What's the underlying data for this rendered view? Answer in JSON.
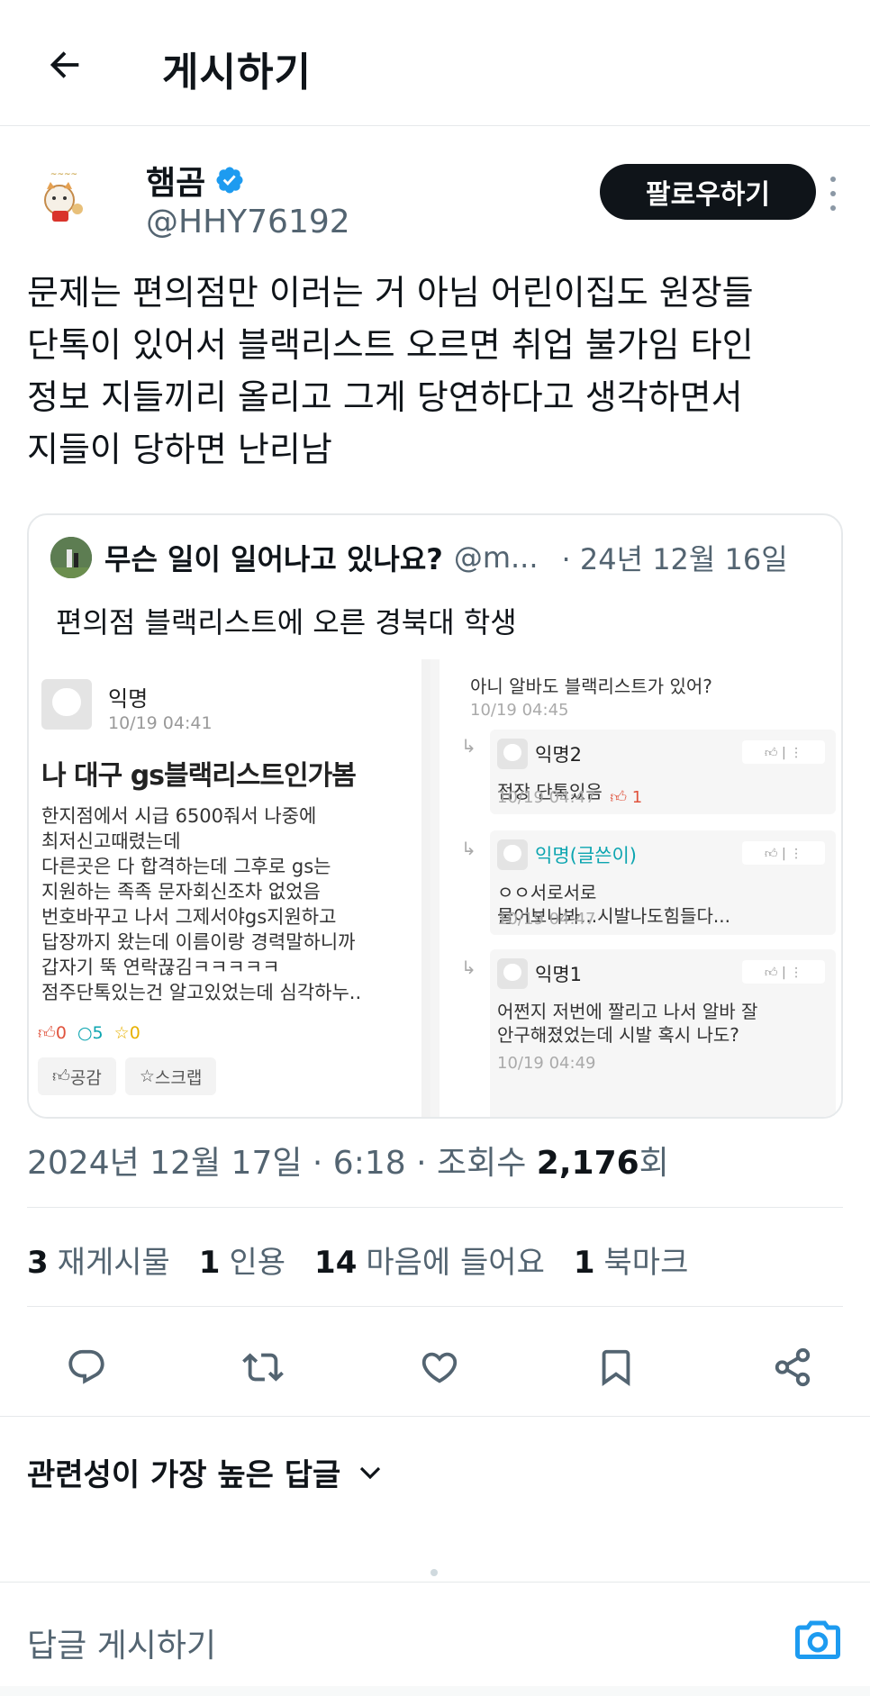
{
  "header": {
    "title": "게시하기"
  },
  "author": {
    "name": "햄곰",
    "handle": "@HHY76192",
    "follow_label": "팔로우하기",
    "verified_color": "#1d9bf0"
  },
  "tweet": {
    "lines": [
      "문제는 편의점만 이러는 거 아님 어린이집도 원장들",
      "단톡이 있어서 블랙리스트 오르면 취업 불가임 타인",
      "정보 지들끼리 올리고 그게 당연하다고 생각하면서",
      "지들이 당하면 난리남"
    ]
  },
  "quote": {
    "name": "무슨 일이 일어나고 있나요?",
    "handle": "@m...",
    "date": "· 24년 12월 16일",
    "text": "편의점 블랙리스트에 오른 경북대 학생",
    "image": {
      "post": {
        "author": "익명",
        "time": "10/19 04:41",
        "title": "나 대구 gs블랙리스트인가봄",
        "body": [
          "한지점에서 시급 6500줘서 나중에",
          "최저신고때렸는데",
          "다른곳은 다 합격하는데 그후로 gs는",
          "지원하는 족족 문자회신조차 없었음",
          "번호바꾸고 나서 그제서야gs지원하고",
          "답장까지 왔는데 이름이랑 경력말하니까",
          "갑자기 뚝 연락끊김ㅋㅋㅋㅋㅋ",
          "점주단톡있는건 알고있었는데 심각하누.."
        ],
        "likes": "0",
        "comments": "5",
        "scraps": "0",
        "like_btn": "공감",
        "scrap_btn": "스크랩"
      },
      "top_comment": {
        "text": "아니 알바도 블랙리스트가 있어?",
        "time": "10/19 04:45"
      },
      "replies": [
        {
          "name": "익명2",
          "text": "점장 단톡있음",
          "time": "10/19 04:47",
          "likes": "1"
        },
        {
          "name": "익명(글쓴이)",
          "text1": "ㅇㅇ서로서로",
          "text2": "물어보나봐...시발나도힘들다...",
          "time": "10/19 04:47"
        },
        {
          "name": "익명1",
          "text1": "어쩐지 저번에 짤리고 나서 알바 잘",
          "text2": "안구해졌었는데 시발 혹시 나도?",
          "time": "10/19 04:49"
        }
      ]
    }
  },
  "timestamp": {
    "text": "2024년 12월 17일 · 6:18 · 조회수 ",
    "views": "2,176",
    "suffix": "회"
  },
  "stats": {
    "retweets": "3",
    "retweets_label": "재게시물",
    "quotes": "1",
    "quotes_label": "인용",
    "likes": "14",
    "likes_label": "마음에 들어요",
    "bookmarks": "1",
    "bookmarks_label": "북마크"
  },
  "sort": {
    "label": "관련성이 가장 높은 답글"
  },
  "reply_box": {
    "placeholder": "답글 게시하기"
  },
  "colors": {
    "accent": "#1d9bf0",
    "text": "#0f1419",
    "muted": "#536471"
  }
}
